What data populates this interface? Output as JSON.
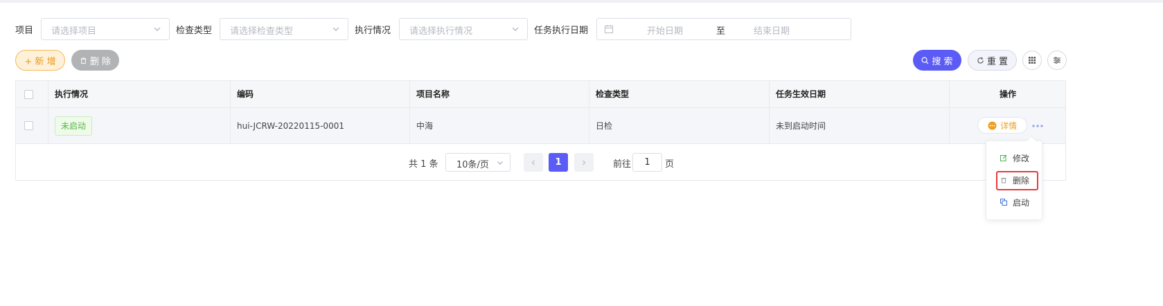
{
  "filters": {
    "project_label": "项目",
    "project_placeholder": "请选择项目",
    "check_type_label": "检查类型",
    "check_type_placeholder": "请选择检查类型",
    "exec_status_label": "执行情况",
    "exec_status_placeholder": "请选择执行情况",
    "date_label": "任务执行日期",
    "start_placeholder": "开始日期",
    "range_sep": "至",
    "end_placeholder": "结束日期"
  },
  "toolbar": {
    "add_label": "+ 新 增",
    "delete_label": "删 除",
    "search_label": "搜 索",
    "reset_label": "重 置"
  },
  "table": {
    "columns": [
      "执行情况",
      "编码",
      "项目名称",
      "检查类型",
      "任务生效日期",
      "操作"
    ],
    "rows": [
      {
        "status": "未启动",
        "code": "hui-JCRW-20220115-0001",
        "project": "中海",
        "check_type": "日检",
        "effective_date": "未到启动时间",
        "detail_label": "详情"
      }
    ]
  },
  "pagination": {
    "total_text": "共 1 条",
    "page_size": "10条/页",
    "current_page": "1",
    "goto_label": "前往",
    "goto_value": "1",
    "page_suffix": "页"
  },
  "row_menu": {
    "items": [
      {
        "label": "修改",
        "icon": "edit-icon"
      },
      {
        "label": "删除",
        "icon": "trash-icon"
      },
      {
        "label": "启动",
        "icon": "start-icon"
      }
    ],
    "highlighted": "删除"
  },
  "colors": {
    "primary": "#5b5cf6",
    "add_accent": "#e89a1e",
    "status_green": "#5ab64a",
    "highlight_red": "#e63a3a"
  }
}
